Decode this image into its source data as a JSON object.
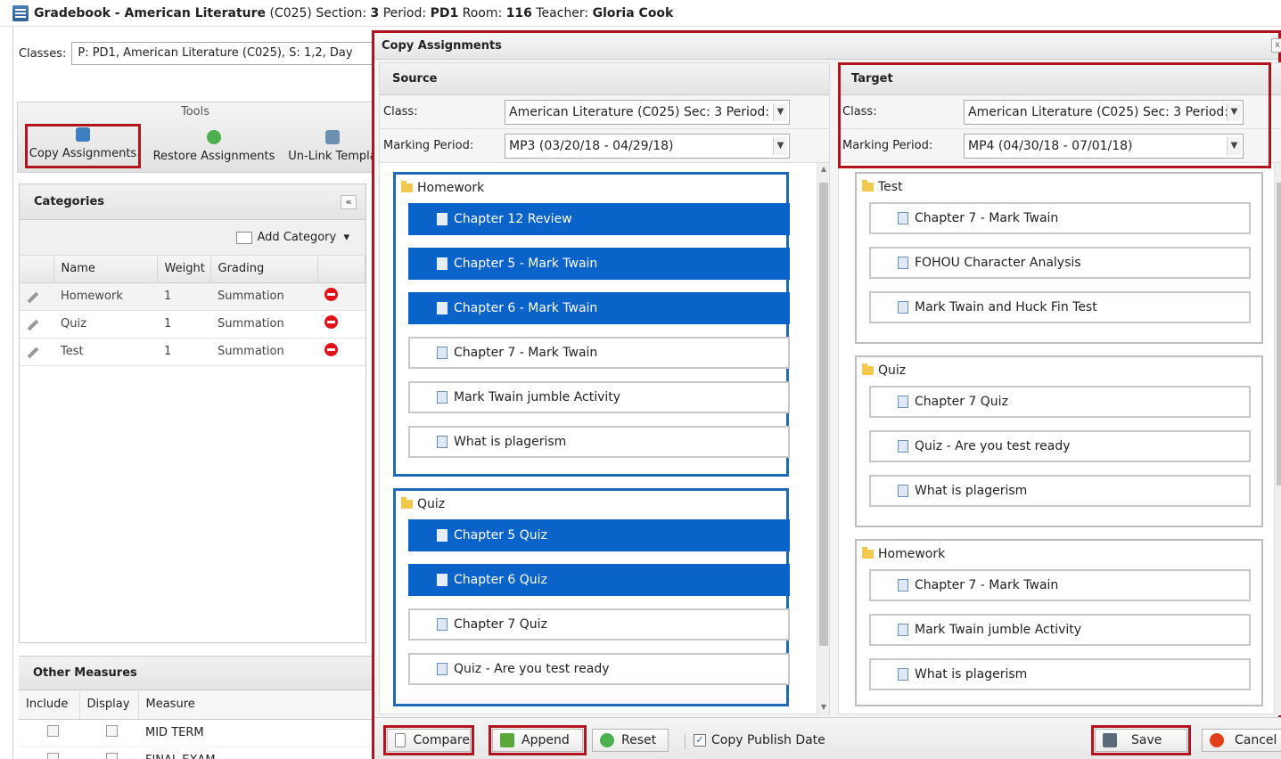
{
  "header": {
    "prefix": "Gradebook - American Literature",
    "course_code": "(C025)",
    "section_label": "Section:",
    "section": "3",
    "period_label": "Period:",
    "period": "PD1",
    "room_label": "Room:",
    "room": "116",
    "teacher_label": "Teacher:",
    "teacher": "Gloria Cook"
  },
  "classes": {
    "label": "Classes:",
    "value": "P: PD1, American Literature (C025), S: 1,2, Day"
  },
  "tools": {
    "title": "Tools",
    "copy": "Copy Assignments",
    "restore": "Restore Assignments",
    "unlink": "Un-Link Templa"
  },
  "categories": {
    "title": "Categories",
    "collapse": "«",
    "add": "Add Category",
    "add_caret": "▾",
    "headers": [
      "Name",
      "Weight",
      "Grading"
    ],
    "rows": [
      {
        "name": "Homework",
        "weight": "1",
        "grading": "Summation"
      },
      {
        "name": "Quiz",
        "weight": "1",
        "grading": "Summation"
      },
      {
        "name": "Test",
        "weight": "1",
        "grading": "Summation"
      }
    ]
  },
  "other_measures": {
    "title": "Other Measures",
    "headers": [
      "Include",
      "Display",
      "Measure"
    ],
    "rows": [
      "MID TERM",
      "FINAL EXAM"
    ]
  },
  "dialog": {
    "title": "Copy Assignments",
    "close": "x",
    "source": {
      "title": "Source",
      "class_label": "Class:",
      "class_value": "American Literature (C025) Sec: 3 Period:",
      "mp_label": "Marking Period:",
      "mp_value": "MP3 (03/20/18 - 04/29/18)",
      "groups": [
        {
          "name": "Homework",
          "items": [
            {
              "label": "Chapter 12 Review",
              "selected": true
            },
            {
              "label": "Chapter 5 - Mark Twain",
              "selected": true
            },
            {
              "label": "Chapter 6 - Mark Twain",
              "selected": true
            },
            {
              "label": "Chapter 7 - Mark Twain",
              "selected": false
            },
            {
              "label": "Mark Twain jumble Activity",
              "selected": false
            },
            {
              "label": "What is plagerism",
              "selected": false
            }
          ]
        },
        {
          "name": "Quiz",
          "items": [
            {
              "label": "Chapter 5 Quiz",
              "selected": true
            },
            {
              "label": "Chapter 6 Quiz",
              "selected": true
            },
            {
              "label": "Chapter 7 Quiz",
              "selected": false
            },
            {
              "label": "Quiz - Are you test ready",
              "selected": false
            }
          ]
        }
      ]
    },
    "target": {
      "title": "Target",
      "class_label": "Class:",
      "class_value": "American Literature (C025) Sec: 3 Period:",
      "mp_label": "Marking Period:",
      "mp_value": "MP4 (04/30/18 - 07/01/18)",
      "groups": [
        {
          "name": "Test",
          "items": [
            "Chapter 7 - Mark Twain",
            "FOHOU Character Analysis",
            "Mark Twain and Huck Fin Test"
          ]
        },
        {
          "name": "Quiz",
          "items": [
            "Chapter 7 Quiz",
            "Quiz - Are you test ready",
            "What is plagerism"
          ]
        },
        {
          "name": "Homework",
          "items": [
            "Chapter 7 - Mark Twain",
            "Mark Twain jumble Activity",
            "What is plagerism"
          ]
        }
      ]
    },
    "footer": {
      "compare": "Compare",
      "append": "Append",
      "reset": "Reset",
      "copy_publish_date": "Copy Publish Date",
      "copy_publish_checked": true,
      "save": "Save",
      "cancel": "Cancel"
    }
  },
  "colors": {
    "highlight": "#b0141c",
    "selection": "#0a63c9",
    "group_border": "#1f6ab5"
  }
}
